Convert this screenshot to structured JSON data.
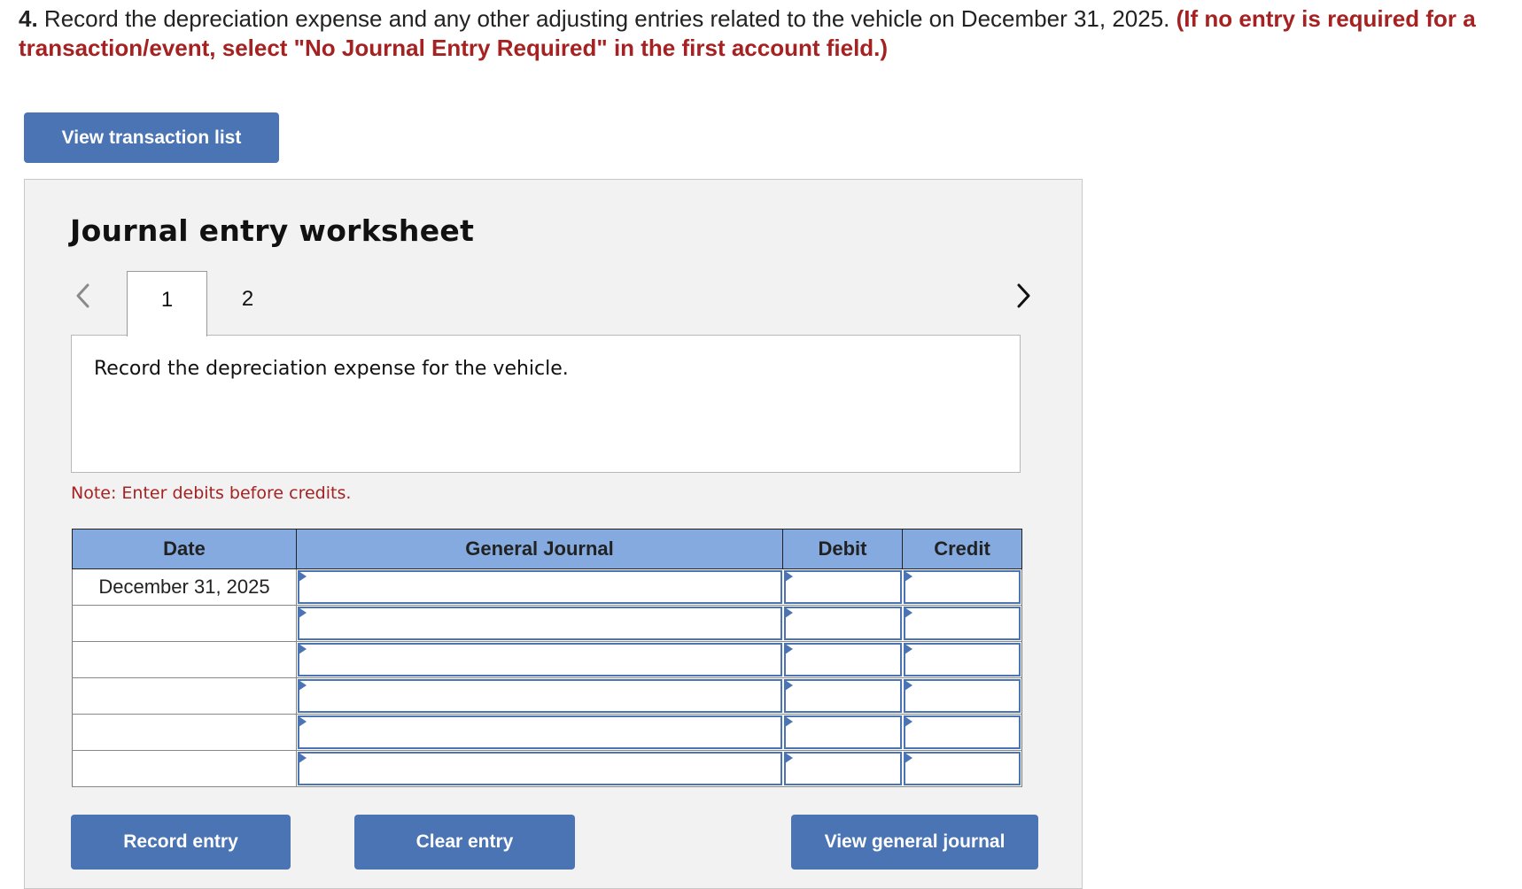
{
  "question": {
    "number": "4.",
    "text": " Record the depreciation expense and any other adjusting entries related to the vehicle on December 31, 2025. ",
    "hint": "(If no entry is required for a transaction/event, select \"No Journal Entry Required\" in the first account field.)"
  },
  "buttons": {
    "view_transaction_list": "View transaction list",
    "record_entry": "Record entry",
    "clear_entry": "Clear entry",
    "view_general_journal": "View general journal"
  },
  "worksheet": {
    "title": "Journal entry worksheet",
    "tabs": [
      {
        "label": "1",
        "active": true
      },
      {
        "label": "2",
        "active": false
      }
    ],
    "description": "Record the depreciation expense for the vehicle.",
    "note": "Note: Enter debits before credits."
  },
  "table": {
    "headers": [
      "Date",
      "General Journal",
      "Debit",
      "Credit"
    ],
    "rows": [
      {
        "date": "December 31, 2025",
        "account": "",
        "debit": "",
        "credit": ""
      },
      {
        "date": "",
        "account": "",
        "debit": "",
        "credit": ""
      },
      {
        "date": "",
        "account": "",
        "debit": "",
        "credit": ""
      },
      {
        "date": "",
        "account": "",
        "debit": "",
        "credit": ""
      },
      {
        "date": "",
        "account": "",
        "debit": "",
        "credit": ""
      },
      {
        "date": "",
        "account": "",
        "debit": "",
        "credit": ""
      }
    ]
  },
  "icons": {
    "prev": "chevron-left-icon",
    "next": "chevron-right-icon"
  },
  "colors": {
    "accent": "#4a74b4",
    "header_bg": "#84aadf",
    "hint_red": "#a62222",
    "panel_bg": "#f2f2f2"
  }
}
